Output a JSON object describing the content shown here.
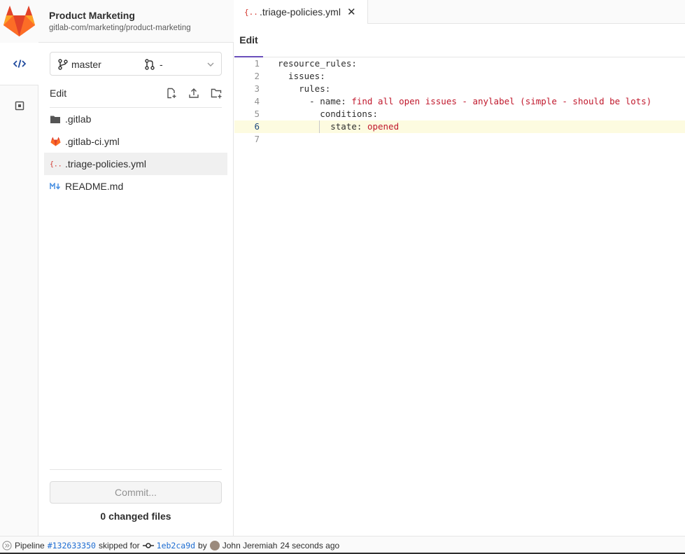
{
  "project": {
    "name": "Product Marketing",
    "path": "gitlab-com/marketing/product-marketing"
  },
  "branch": {
    "name": "master",
    "merge_request": "-"
  },
  "sidebar": {
    "edit_label": "Edit",
    "files": [
      {
        "name": ".gitlab",
        "icon": "folder-icon"
      },
      {
        "name": ".gitlab-ci.yml",
        "icon": "gitlab-ci-icon"
      },
      {
        "name": ".triage-policies.yml",
        "icon": "yaml-icon"
      },
      {
        "name": "README.md",
        "icon": "markdown-icon"
      }
    ],
    "commit_button": "Commit...",
    "changed_files": "0 changed files"
  },
  "editor": {
    "tab_label": ".triage-policies.yml",
    "mode_label": "Edit",
    "line_numbers": [
      "1",
      "2",
      "3",
      "4",
      "5",
      "6",
      "7"
    ],
    "lines": [
      {
        "key": "resource_rules:",
        "value": ""
      },
      {
        "key": "  issues:",
        "value": ""
      },
      {
        "key": "    rules:",
        "value": ""
      },
      {
        "key": "      - name: ",
        "value": "find all open issues - anylabel (simple - should be lots)"
      },
      {
        "key": "        conditions:",
        "value": ""
      },
      {
        "key": "          state: ",
        "value": "opened"
      },
      {
        "key": "",
        "value": ""
      }
    ]
  },
  "status": {
    "pipeline_label": "Pipeline",
    "pipeline_id": "#132633350",
    "skipped_for": "skipped for",
    "commit_sha": "1eb2ca9d",
    "by": "by",
    "author": "John Jeremiah",
    "time_ago": "24 seconds ago"
  },
  "colors": {
    "accent": "#6b4fbb",
    "string": "#c0182c",
    "link": "#1f6ed3",
    "current_line": "#fdfbe0"
  }
}
